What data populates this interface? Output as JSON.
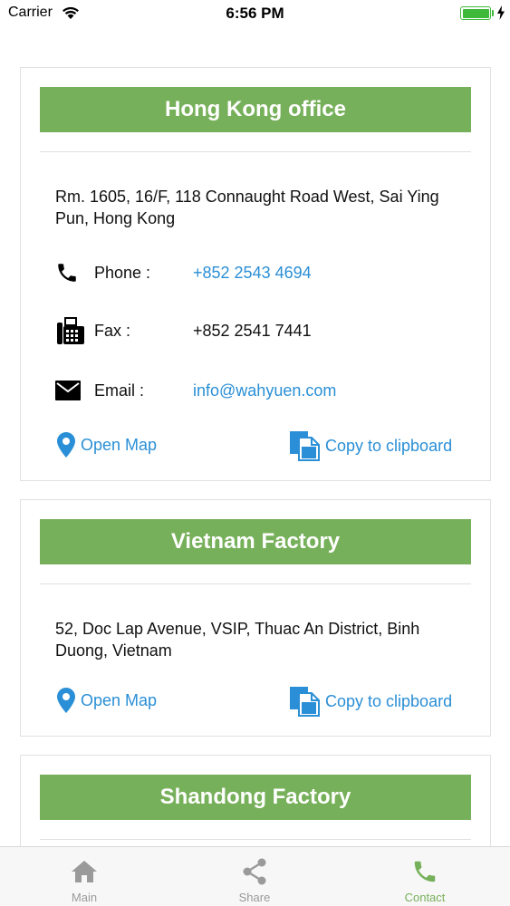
{
  "status_bar": {
    "carrier": "Carrier",
    "time": "6:56 PM"
  },
  "offices": [
    {
      "title": "Hong Kong office",
      "address": "Rm. 1605, 16/F, 118 Connaught Road West, Sai Ying Pun, Hong Kong",
      "phone_label": "Phone :",
      "phone": "+852 2543 4694",
      "fax_label": "Fax :",
      "fax": "+852 2541 7441",
      "email_label": "Email :",
      "email": "info@wahyuen.com",
      "open_map": "Open Map",
      "copy": "Copy to clipboard"
    },
    {
      "title": "Vietnam Factory",
      "address": "52, Doc Lap Avenue, VSIP, Thuac An District, Binh Duong, Vietnam",
      "open_map": "Open Map",
      "copy": "Copy to clipboard"
    },
    {
      "title": "Shandong Factory"
    }
  ],
  "tabs": [
    {
      "label": "Main",
      "icon": "home-icon"
    },
    {
      "label": "Share",
      "icon": "share-icon"
    },
    {
      "label": "Contact",
      "icon": "phone-icon",
      "active": true
    }
  ],
  "colors": {
    "accent": "#77b05a",
    "link": "#2a8fd6",
    "battery": "#3fb93a"
  }
}
